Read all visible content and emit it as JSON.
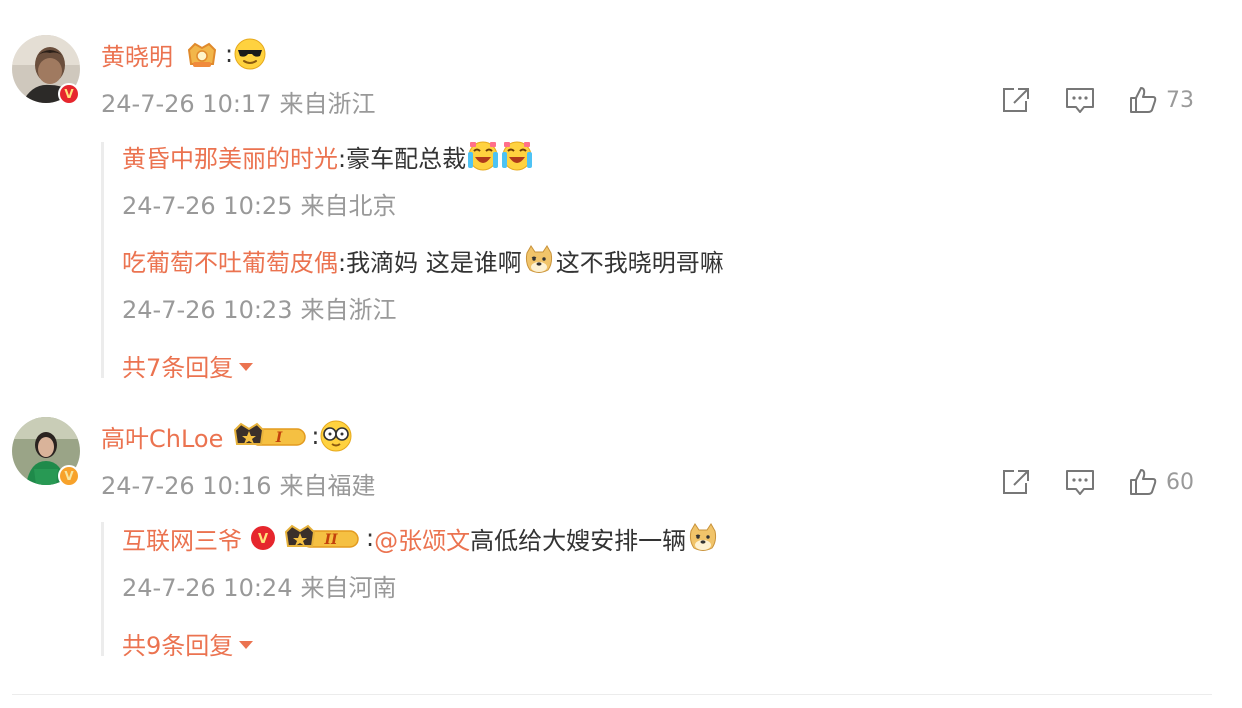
{
  "comments": [
    {
      "author": "黄晓明",
      "colon": ":",
      "timestamp": "24-7-26 10:17",
      "source": "来自浙江",
      "likes": "73",
      "verified_color": "#e6262d",
      "badge_icon": "fan-crown-badge-icon",
      "content_emoji": "cool-sunglasses-emoji",
      "replies": [
        {
          "author": "黄昏中那美丽的时光",
          "text": ":豪车配总裁",
          "emojis": [
            "crying-laughing-emoji",
            "crying-laughing-emoji"
          ],
          "timestamp": "24-7-26 10:25",
          "source": "来自北京"
        },
        {
          "author": "吃葡萄不吐葡萄皮偶",
          "text_before": ":我滴妈 这是谁啊",
          "text_after": "这不我晓明哥嘛",
          "emoji": "doge-emoji",
          "timestamp": "24-7-26 10:23",
          "source": "来自浙江"
        }
      ],
      "more_replies": "共7条回复"
    },
    {
      "author": "高叶ChLoe",
      "colon": ":",
      "timestamp": "24-7-26 10:16",
      "source": "来自福建",
      "likes": "60",
      "verified_color": "#f7a22b",
      "badge_icon": "crown-level-1-badge-icon",
      "badge_level": "I",
      "content_emoji": "clapping-glasses-emoji",
      "replies": [
        {
          "author": "互联网三爷",
          "badge_level": "II",
          "text_prefix": ":",
          "mention": "@张颂文",
          "text": " 高低给大嫂安排一辆",
          "emoji": "doge-emoji",
          "timestamp": "24-7-26 10:24",
          "source": "来自河南"
        }
      ],
      "more_replies": "共9条回复"
    }
  ],
  "icons": {
    "share": "share-icon",
    "comment": "comment-icon",
    "like": "like-icon"
  },
  "colors": {
    "name": "#eb7350",
    "meta": "#999999",
    "text": "#333333"
  }
}
